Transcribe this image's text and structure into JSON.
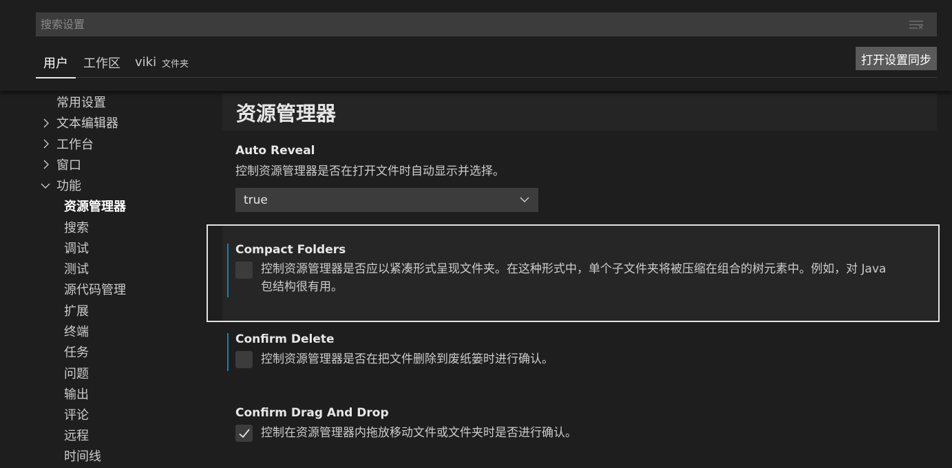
{
  "search": {
    "placeholder": "搜索设置"
  },
  "tabs": [
    {
      "label": "用户"
    },
    {
      "label": "工作区"
    },
    {
      "label": "viki",
      "sub": "文件夹"
    }
  ],
  "sync_button": "打开设置同步",
  "toc": {
    "items": [
      {
        "label": "常用设置"
      },
      {
        "label": "文本编辑器"
      },
      {
        "label": "工作台"
      },
      {
        "label": "窗口"
      },
      {
        "label": "功能"
      },
      {
        "label": "资源管理器"
      },
      {
        "label": "搜索"
      },
      {
        "label": "调试"
      },
      {
        "label": "测试"
      },
      {
        "label": "源代码管理"
      },
      {
        "label": "扩展"
      },
      {
        "label": "终端"
      },
      {
        "label": "任务"
      },
      {
        "label": "问题"
      },
      {
        "label": "输出"
      },
      {
        "label": "评论"
      },
      {
        "label": "远程"
      },
      {
        "label": "时间线"
      }
    ]
  },
  "section": {
    "title": "资源管理器"
  },
  "settings": [
    {
      "title": "Auto Reveal",
      "description": "控制资源管理器是否在打开文件时自动显示并选择。",
      "value": "true"
    },
    {
      "title": "Compact Folders",
      "description_line1": "控制资源管理器是否应以紧凑形式呈现文件夹。在这种形式中，单个子文件夹将被压缩在组合的树元素中。例如，对 Java",
      "description_line2": "包结构很有用。",
      "checked": false
    },
    {
      "title": "Confirm Delete",
      "description": "控制资源管理器是否在把文件删除到废纸篓时进行确认。",
      "checked": false
    },
    {
      "title": "Confirm Drag And Drop",
      "description": "控制在资源管理器内拖放移动文件或文件夹时是否进行确认。",
      "checked": true
    }
  ],
  "colors": {
    "background": "#1e1e1e",
    "input_background": "#3c3c3c",
    "modified_indicator": "#1b80b2",
    "focus_border": "#e4e4e4"
  }
}
